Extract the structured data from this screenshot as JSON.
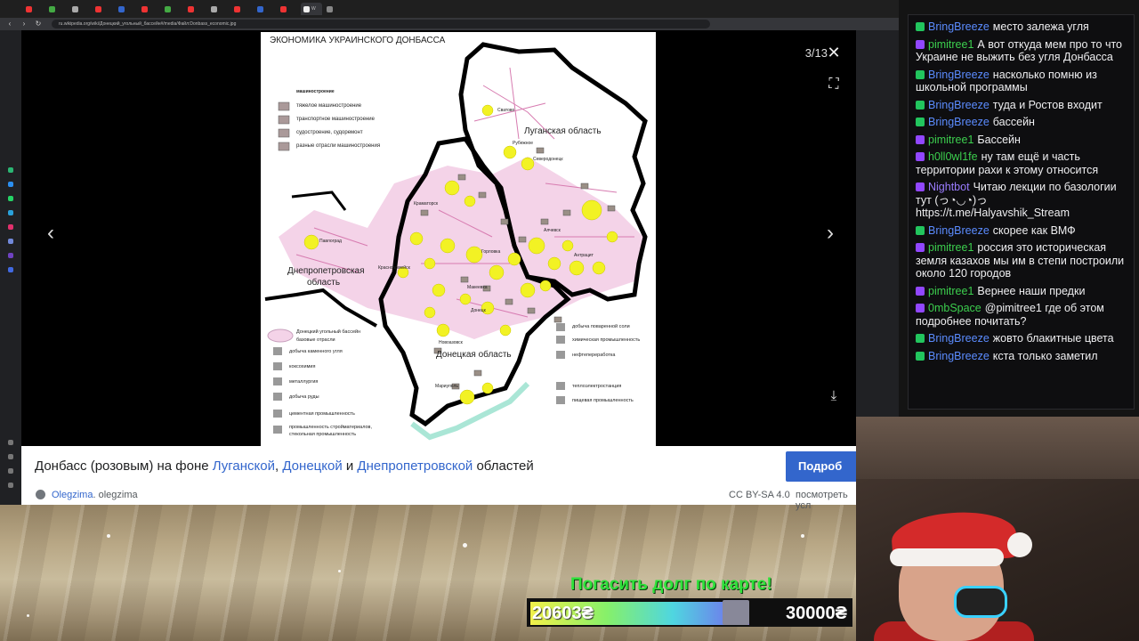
{
  "browser": {
    "url": "ru.wikipedia.org/wiki/Донецкий_угольный_бассейн#/media/Файл:Donbass_economic.jpg",
    "tab_active_label": "W"
  },
  "viewer": {
    "counter": "3/13",
    "close_glyph": "✕",
    "fullscreen_glyph": "⛶",
    "prev_glyph": "‹",
    "next_glyph": "›",
    "download_glyph": "⤓"
  },
  "map": {
    "title": "ЭКОНОМИКА УКРАИНСКОГО ДОНБАССА",
    "region_lugansk": "Луганская область",
    "region_dnepr_1": "Днепропетровская",
    "region_dnepr_2": "область",
    "region_donetsk": "Донецкая область",
    "legend_top": {
      "header": "машиностроение",
      "items": [
        "тяжелое машиностроение",
        "транспортное машиностроение",
        "судостроение, судоремонт",
        "разные отрасли машиностроения"
      ]
    },
    "legend_left": {
      "header_1": "Донецкий угольный бассейн",
      "header_2": "базовые отрасли",
      "items": [
        "добыча каменного угля",
        "коксохимия",
        "металлургия",
        "добыча руды",
        "цементная промышленность",
        "промышленность стройматериалов,",
        "стекольная промышленность"
      ]
    },
    "legend_right": {
      "items": [
        "добыча поваренной соли",
        "химическая промышленность",
        "нефтепереработка",
        "теплоэлектростанция",
        "пищевая промышленность"
      ]
    },
    "towns": [
      "Павлоград",
      "Краматорск",
      "Северодонецк",
      "Рубежное",
      "Мариуполь",
      "Новоазовск",
      "Макеевка",
      "Горловка",
      "Алчевск",
      "Антрацит",
      "Красноармейск",
      "Донецк",
      "Сватово"
    ]
  },
  "caption": {
    "prefix": "Донбасс (розовым) на фоне ",
    "link1": "Луганской",
    "sep": ", ",
    "link2": "Донецкой",
    "mid": " и ",
    "link3": "Днепропетровской",
    "suffix": " областей",
    "more_button": "Подроб"
  },
  "attribution": {
    "author_link": "Olegzima",
    "author_rest": ". olegzima",
    "license": "CC BY-SA 4.0",
    "terms": "посмотреть усл"
  },
  "chat": {
    "messages": [
      {
        "nick": "BringBreeze",
        "color": "#5b8cff",
        "badge": "#22c55e",
        "text": "место залежа угля"
      },
      {
        "nick": "pimitree1",
        "color": "#3ccf4e",
        "badge": "#9147ff",
        "text": "А вот откуда мем про то что Украине не выжить без угля Донбасса"
      },
      {
        "nick": "BringBreeze",
        "color": "#5b8cff",
        "badge": "#22c55e",
        "text": "насколько помню из школьной программы"
      },
      {
        "nick": "BringBreeze",
        "color": "#5b8cff",
        "badge": "#22c55e",
        "text": "туда и Ростов входит"
      },
      {
        "nick": "BringBreeze",
        "color": "#5b8cff",
        "badge": "#22c55e",
        "text": "бассейн"
      },
      {
        "nick": "pimitree1",
        "color": "#3ccf4e",
        "badge": "#9147ff",
        "text": "Бассейн"
      },
      {
        "nick": "h0ll0wl1fe",
        "color": "#3ccf4e",
        "badge": "#9147ff",
        "text": "ну там ещё и часть территории рахи к этому относится"
      },
      {
        "nick": "Nightbot",
        "color": "#9a7cff",
        "badge": "#9147ff",
        "text": "Читаю лекции по базологии тут (っ◔◡◔)っ https://t.me/Halyavshik_Stream"
      },
      {
        "nick": "BringBreeze",
        "color": "#5b8cff",
        "badge": "#22c55e",
        "text": "скорее как ВМФ"
      },
      {
        "nick": "pimitree1",
        "color": "#3ccf4e",
        "badge": "#9147ff",
        "text": "россия это историческая земля казахов мы им в степи построили около 120 городов"
      },
      {
        "nick": "pimitree1",
        "color": "#3ccf4e",
        "badge": "#9147ff",
        "text": "Вернее наши предки"
      },
      {
        "nick": "0mbSpace",
        "color": "#3ccf4e",
        "badge": "#9147ff",
        "text": "@pimitree1 где об этом подробнее почитать?"
      },
      {
        "nick": "BringBreeze",
        "color": "#5b8cff",
        "badge": "#22c55e",
        "text": "жовто блакитные цвета"
      },
      {
        "nick": "BringBreeze",
        "color": "#5b8cff",
        "badge": "#22c55e",
        "text": "кста только заметил"
      }
    ]
  },
  "goal": {
    "title": "Погасить долг по карте!",
    "current": "20603₴",
    "target": "30000₴",
    "progress": 0.687
  }
}
